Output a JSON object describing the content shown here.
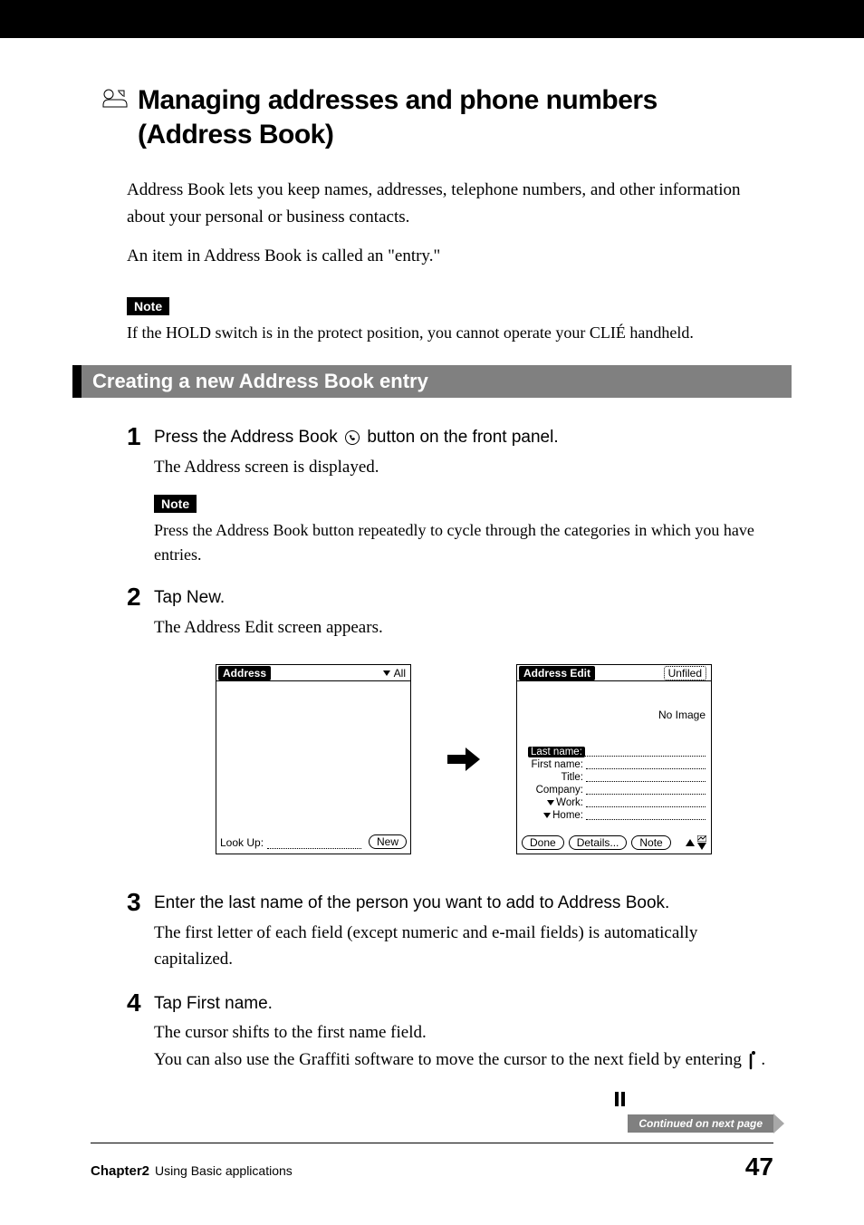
{
  "title": "Managing addresses and phone numbers (Address Book)",
  "intro": {
    "p1": "Address Book lets you keep names, addresses, telephone numbers, and other information about your personal or business contacts.",
    "p2": "An item in Address Book is called an \"entry.\""
  },
  "note1": {
    "label": "Note",
    "text": "If the HOLD switch is in the protect position, you cannot operate your CLIÉ handheld."
  },
  "section_heading": "Creating a new Address Book entry",
  "steps": {
    "s1": {
      "num": "1",
      "title_pre": "Press the Address Book ",
      "title_post": " button on the front panel.",
      "desc": "The Address screen is displayed.",
      "note_label": "Note",
      "note_text": "Press the Address Book button repeatedly to cycle through the categories in which you have entries."
    },
    "s2": {
      "num": "2",
      "title": "Tap New.",
      "desc": "The Address Edit screen appears."
    },
    "s3": {
      "num": "3",
      "title": "Enter the last name of the person you want to add to Address Book.",
      "desc": "The first letter of each field (except numeric and e-mail fields) is automatically capitalized."
    },
    "s4": {
      "num": "4",
      "title": "Tap First name.",
      "desc1": "The cursor shifts to the first name field.",
      "desc2_pre": "You can also use the Graffiti software to move the cursor to the next field by entering ",
      "desc2_post": " ."
    }
  },
  "screens": {
    "address": {
      "title": "Address",
      "category": "All",
      "lookup_label": "Look Up:",
      "new_button": "New"
    },
    "addressEdit": {
      "title": "Address Edit",
      "category": "Unfiled",
      "noimage": "No Image",
      "fields": {
        "last": "Last name:",
        "first": "First name:",
        "title": "Title:",
        "company": "Company:",
        "work": "Work:",
        "home": "Home:"
      },
      "buttons": {
        "done": "Done",
        "details": "Details...",
        "note": "Note"
      }
    }
  },
  "continued": "Continued on next page",
  "footer": {
    "chapter": "Chapter2",
    "chapter_title": "Using Basic applications",
    "page": "47"
  }
}
